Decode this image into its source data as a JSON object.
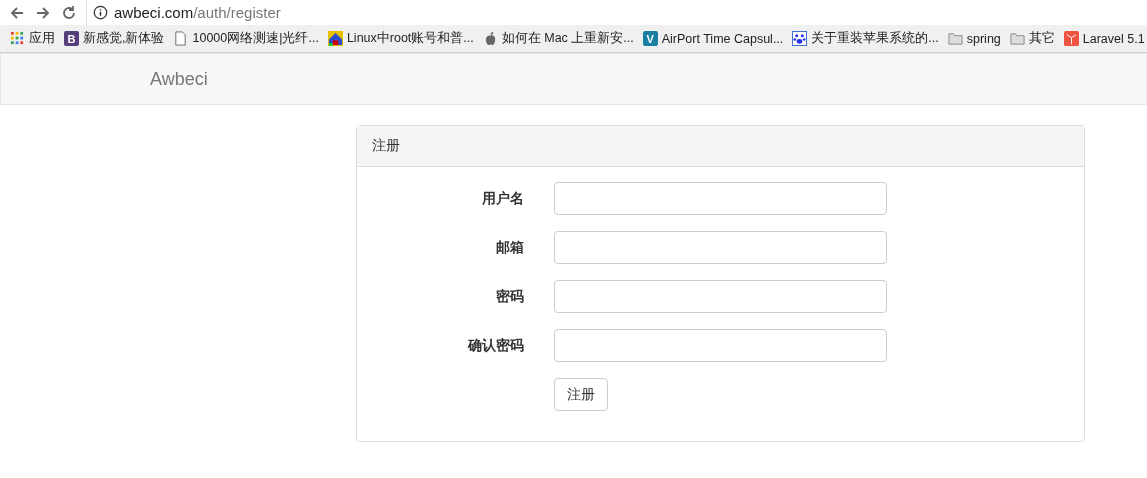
{
  "browser": {
    "url_host": "awbeci.com",
    "url_path": "/auth/register"
  },
  "bookmarks": [
    {
      "kind": "apps",
      "label": "应用"
    },
    {
      "kind": "letter",
      "letter": "B",
      "color": "#563d7c",
      "label": "新感觉,新体验"
    },
    {
      "kind": "page",
      "label": "10000网络测速|光纤..."
    },
    {
      "kind": "mosaic",
      "label": "Linux中root账号和普..."
    },
    {
      "kind": "apple",
      "label": "如何在 Mac 上重新安..."
    },
    {
      "kind": "letter",
      "letter": "V",
      "color": "#1a7fa0",
      "label": "AirPort Time Capsul..."
    },
    {
      "kind": "paw",
      "label": "关于重装苹果系统的..."
    },
    {
      "kind": "folder",
      "label": "spring"
    },
    {
      "kind": "folder",
      "label": "其它"
    },
    {
      "kind": "laravel",
      "label": "Laravel 5.1"
    }
  ],
  "navbar": {
    "brand": "Awbeci"
  },
  "panel": {
    "title": "注册",
    "fields": [
      {
        "label": "用户名"
      },
      {
        "label": "邮箱"
      },
      {
        "label": "密码"
      },
      {
        "label": "确认密码"
      }
    ],
    "submit": "注册"
  }
}
